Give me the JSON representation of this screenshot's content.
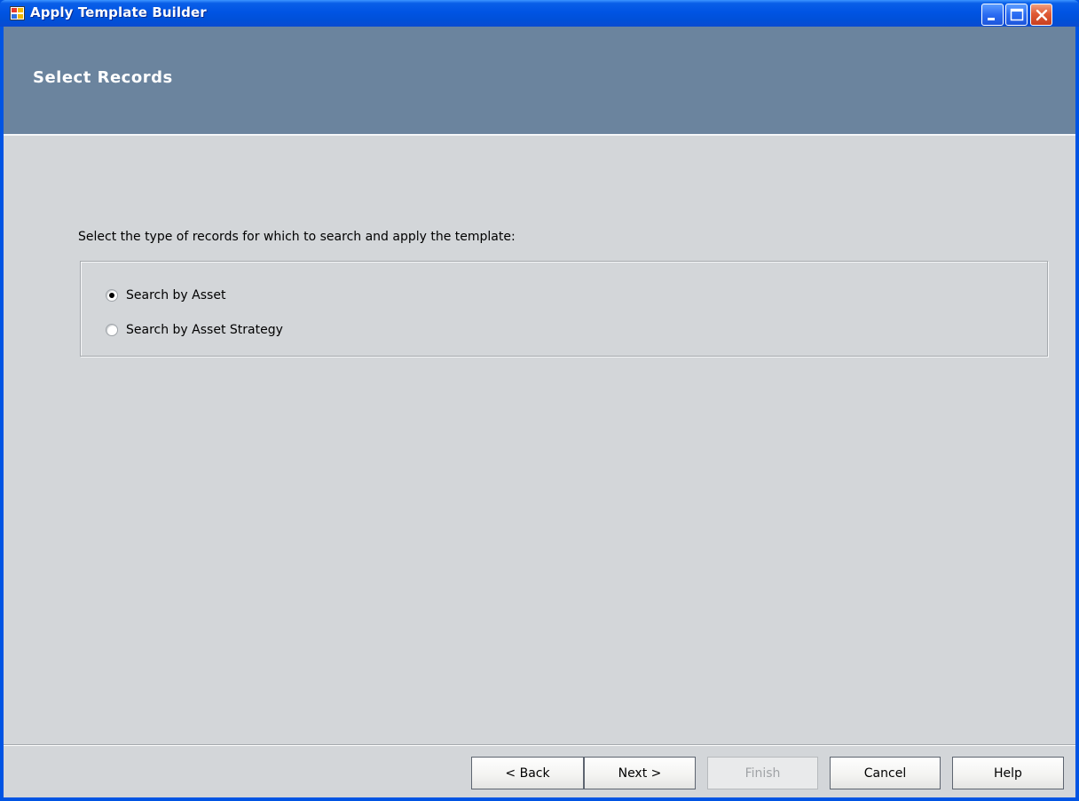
{
  "window": {
    "title": "Apply Template Builder",
    "buttons": {
      "minimize": "minimize",
      "maximize": "maximize",
      "close": "close"
    }
  },
  "header": {
    "title": "Select Records"
  },
  "main": {
    "instruction": "Select the type of records for which to search and apply the  template:",
    "options": [
      {
        "label": "Search by Asset",
        "selected": true
      },
      {
        "label": "Search by Asset Strategy",
        "selected": false
      }
    ]
  },
  "footer": {
    "back_label": "< Back",
    "next_label": "Next >",
    "finish_label": "Finish",
    "cancel_label": "Cancel",
    "help_label": "Help"
  },
  "colors": {
    "title_bar": "#0054e3",
    "header_band": "#6b849e",
    "client_bg": "#d3d6d9"
  }
}
